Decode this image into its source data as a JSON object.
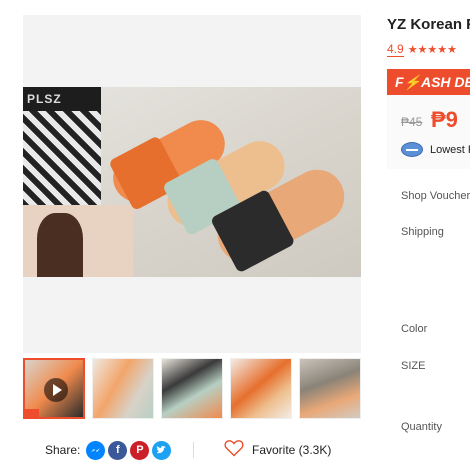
{
  "product": {
    "title": "YZ Korean Fa",
    "rating": "4.9",
    "stars": "★★★★★"
  },
  "flash_sale": {
    "label": "F⚡ASH DEA"
  },
  "price": {
    "original": "₱45",
    "current": "₱9",
    "lowest_label": "Lowest F"
  },
  "options": {
    "shop_vouchers": "Shop Vouchers",
    "shipping": "Shipping",
    "color": "Color",
    "size": "SIZE",
    "quantity": "Quantity"
  },
  "gallery": {
    "bag_text": "PLSZ",
    "thumbnail_count": 5
  },
  "share": {
    "label": "Share:",
    "networks": [
      "messenger-icon",
      "facebook-icon",
      "pinterest-icon",
      "twitter-icon"
    ]
  },
  "favorite": {
    "label": "Favorite (3.3K)"
  },
  "colors": {
    "accent": "#ee4d2d"
  }
}
